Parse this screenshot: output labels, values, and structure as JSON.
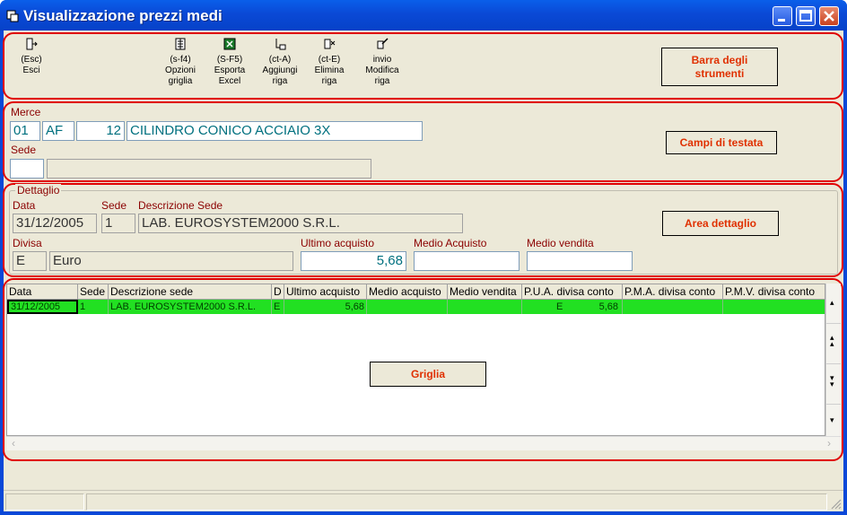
{
  "window": {
    "title": "Visualizzazione prezzi medi"
  },
  "toolbar": {
    "items": [
      {
        "key": "(Esc)",
        "label": "Esci",
        "icon": "exit-door-icon"
      },
      {
        "key": "(s-f4)",
        "label": "Opzioni griglia",
        "icon": "grid-options-icon"
      },
      {
        "key": "(S-F5)",
        "label": "Esporta Excel",
        "icon": "excel-icon"
      },
      {
        "key": "(ct-A)",
        "label": "Aggiungi riga",
        "icon": "add-row-icon"
      },
      {
        "key": "(ct-E)",
        "label": "Elimina riga",
        "icon": "delete-row-icon"
      },
      {
        "key": "invio",
        "label": "Modifica riga",
        "icon": "edit-row-icon"
      }
    ]
  },
  "callouts": {
    "toolbar": "Barra degli strumenti",
    "header": "Campi di testata",
    "detail": "Area dettaglio",
    "grid": "Griglia"
  },
  "header": {
    "merce_label": "Merce",
    "merce_code1": "01",
    "merce_code2": "AF",
    "merce_code3": "12",
    "merce_desc": "CILINDRO CONICO ACCIAIO 3X",
    "sede_label": "Sede",
    "sede_code": "",
    "sede_desc": ""
  },
  "detail": {
    "group_title": "Dettaglio",
    "data_label": "Data",
    "data_value": "31/12/2005",
    "sede_label": "Sede",
    "sede_value": "1",
    "desc_sede_label": "Descrizione Sede",
    "desc_sede_value": "LAB. EUROSYSTEM2000 S.R.L.",
    "divisa_label": "Divisa",
    "divisa_code": "E",
    "divisa_desc": "Euro",
    "ultimo_acquisto_label": "Ultimo acquisto",
    "ultimo_acquisto_value": "5,68",
    "medio_acquisto_label": "Medio Acquisto",
    "medio_acquisto_value": "",
    "medio_vendita_label": "Medio vendita",
    "medio_vendita_value": ""
  },
  "grid": {
    "columns": [
      "Data",
      "Sede",
      "Descrizione sede",
      "D",
      "Ultimo acquisto",
      "Medio acquisto",
      "Medio vendita",
      "P.U.A. divisa conto",
      "P.M.A. divisa conto",
      "P.M.V. divisa conto"
    ],
    "rows": [
      {
        "data": "31/12/2005",
        "sede": "1",
        "descrizione": "LAB. EUROSYSTEM2000 S.R.L.",
        "d": "E",
        "ultimo_acquisto": "5,68",
        "medio_acquisto": "",
        "medio_vendita": "",
        "pua_divisa": "E",
        "pua_value": "5,68",
        "pma": "",
        "pmv": ""
      }
    ]
  },
  "colors": {
    "accent_red": "#e00000",
    "selected_row": "#22e022",
    "titlebar": "#0a49d6"
  }
}
